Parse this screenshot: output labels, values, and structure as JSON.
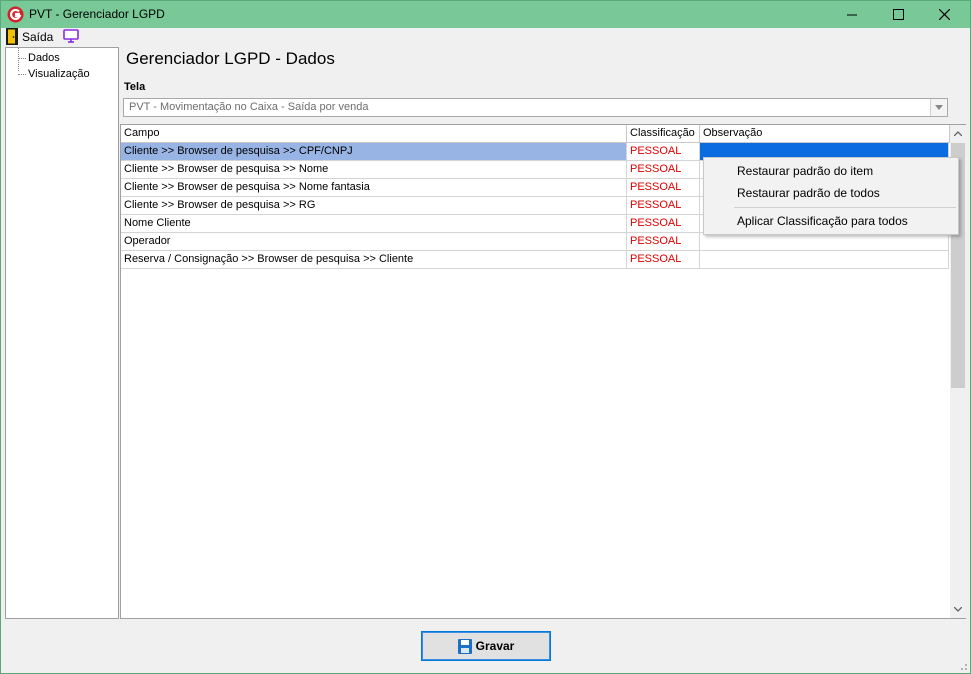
{
  "window": {
    "title": "PVT - Gerenciador LGPD",
    "accent_color": "#78c898",
    "controls": [
      "minimize-icon",
      "maximize-icon",
      "close-icon"
    ]
  },
  "toolbar": {
    "exit_label": "Saída",
    "exit_icon": "exit-door-icon",
    "screen_icon": "monitor-icon"
  },
  "tree": {
    "items": [
      {
        "label": "Dados"
      },
      {
        "label": "Visualização"
      }
    ]
  },
  "main": {
    "title": "Gerenciador LGPD - Dados",
    "tela_label": "Tela",
    "tela_value": "PVT - Movimentação no Caixa - Saída por venda"
  },
  "grid": {
    "columns": [
      "Campo",
      "Classificação",
      "Observação"
    ],
    "rows": [
      {
        "campo": "Cliente >> Browser de pesquisa >> CPF/CNPJ",
        "classificacao": "PESSOAL",
        "observacao": ""
      },
      {
        "campo": "Cliente >> Browser de pesquisa >> Nome",
        "classificacao": "PESSOAL",
        "observacao": ""
      },
      {
        "campo": "Cliente >> Browser de pesquisa >> Nome fantasia",
        "classificacao": "PESSOAL",
        "observacao": ""
      },
      {
        "campo": "Cliente >> Browser de pesquisa >> RG",
        "classificacao": "PESSOAL",
        "observacao": ""
      },
      {
        "campo": "Nome Cliente",
        "classificacao": "PESSOAL",
        "observacao": ""
      },
      {
        "campo": "Operador",
        "classificacao": "PESSOAL",
        "observacao": ""
      },
      {
        "campo": "Reserva / Consignação >> Browser de pesquisa >> Cliente",
        "classificacao": "PESSOAL",
        "observacao": ""
      }
    ],
    "classification_color": "#e00000",
    "selected_row_color": "#98b4e4",
    "selected_cell_color": "#0a6ce0"
  },
  "context_menu": {
    "items": [
      "Restaurar padrão do item",
      "Restaurar padrão de todos",
      "Aplicar Classificação para todos"
    ]
  },
  "footer": {
    "save_label": "Gravar",
    "save_icon": "floppy-disk-icon"
  }
}
